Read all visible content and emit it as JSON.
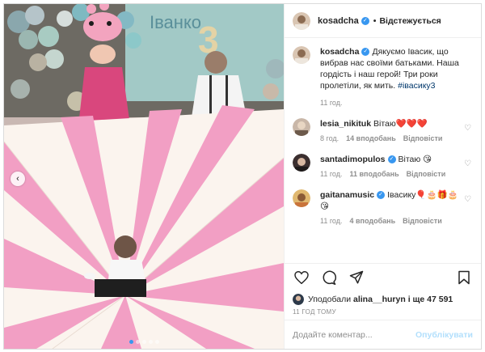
{
  "post": {
    "author": "kosadcha",
    "follow_label": "Відстежується",
    "separator": "•"
  },
  "comments": [
    {
      "user": "kosadcha",
      "text": "Дякуємо Івасик, що вибрав нас своїми батьками. Наша гордість і наш герой! Три роки пролетіли, як мить.",
      "hashtag": "#івасику3",
      "time": "11 год.",
      "likes": "",
      "reply": ""
    },
    {
      "user": "lesia_nikituk",
      "text": "Вітаю❤️❤️❤️",
      "time": "8 год.",
      "likes": "14 вподобань",
      "reply": "Відповісти"
    },
    {
      "user": "santadimopulos",
      "text": "Вітаю 😘",
      "time": "11 год.",
      "likes": "11 вподобань",
      "reply": "Відповісти"
    },
    {
      "user": "gaitanamusic",
      "text": "Івасику🎈🎂🎁🎂😘",
      "time": "11 год.",
      "likes": "4 вподобань",
      "reply": "Відповісти"
    }
  ],
  "likes_line": {
    "prefix": "Уподобали",
    "user": "alina__huryn",
    "suffix": "і ще 47 591"
  },
  "time_ago": "11 ГОД ТОМУ",
  "add_comment": {
    "placeholder": "Додайте коментар...",
    "publish_label": "Опублікувати"
  },
  "photo": {
    "backdrop_number": "3",
    "backdrop_text": "Іванко",
    "slide_count": 5,
    "active_slide": 1
  },
  "colors": {
    "accent": "#3897f0",
    "hashtag": "#00376b",
    "muted": "#8e8e8e",
    "publish_disabled": "#b2dffc",
    "parachute_pink": "#f29fc4",
    "parachute_white": "#fbf4ee"
  },
  "icons": [
    "verified-badge-icon",
    "heart-icon",
    "comment-icon",
    "share-icon",
    "bookmark-icon",
    "carousel-arrow-icon"
  ]
}
